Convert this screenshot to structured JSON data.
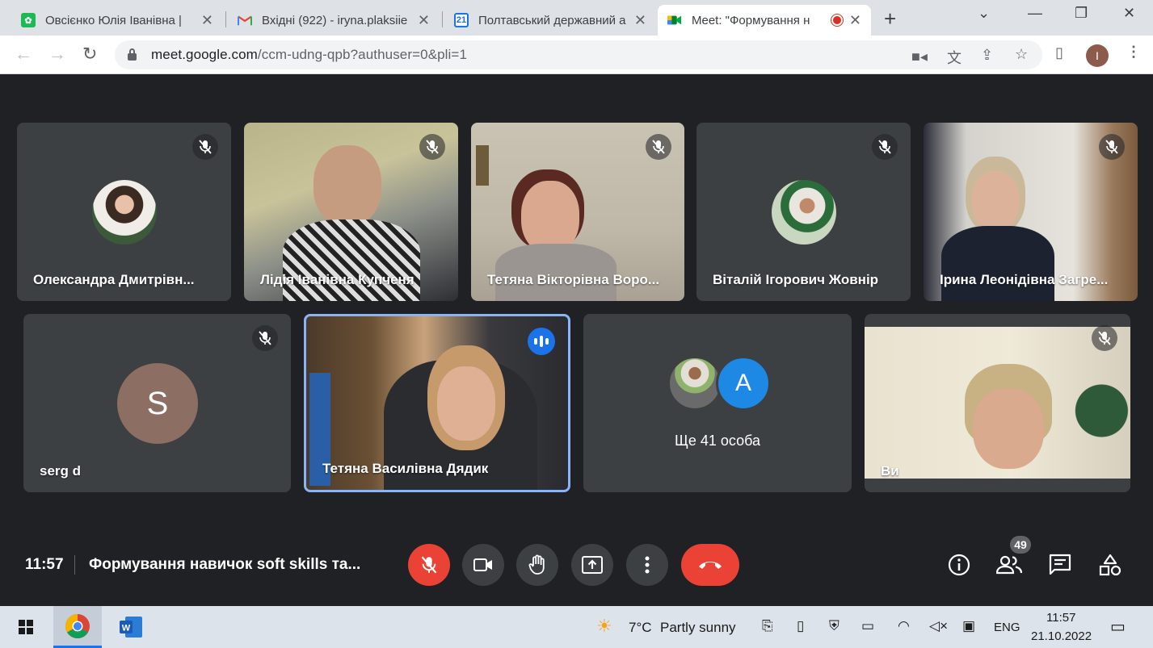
{
  "browser": {
    "tabs": [
      {
        "title": "Овсієнко Юлія Іванівна | ",
        "favicon": "green-app-icon",
        "color": "#1db954"
      },
      {
        "title": "Вхідні (922) - iryna.plaksiie",
        "favicon": "gmail-icon",
        "color": "#ea4335"
      },
      {
        "title": "Полтавський державний а",
        "favicon": "calendar-icon",
        "color": "#1a73e8",
        "favicon_text": "21"
      },
      {
        "title": "Meet: \"Формування н",
        "favicon": "meet-icon",
        "color": "#00832d"
      }
    ],
    "url_main": "meet.google.com",
    "url_rest": "/ccm-udng-qpb?authuser=0&pli=1",
    "profile_initial": "I"
  },
  "meeting": {
    "participants": [
      {
        "name": "Олександра Дмитрівн...",
        "muted": true
      },
      {
        "name": "Лідія Іванівна Купченя",
        "muted": true
      },
      {
        "name": "Тетяна Вікторівна Воро...",
        "muted": true
      },
      {
        "name": "Віталій Ігорович Жовнір",
        "muted": true
      },
      {
        "name": "Ірина Леонідівна Загре...",
        "muted": true
      },
      {
        "name": "serg d",
        "muted": true,
        "initial": "S",
        "avatar_color": "#8d6e63"
      },
      {
        "name": "Тетяна Василівна Дядик",
        "muted": false,
        "speaking": true
      },
      {
        "name": "Ви",
        "muted": true
      }
    ],
    "others": {
      "label": "Ще 41 особа",
      "initial": "A",
      "avatar_color": "#1e88e5"
    },
    "time": "11:57",
    "title": "Формування навичок soft skills та...",
    "people_count": "49"
  },
  "taskbar": {
    "weather_temp": "7°C",
    "weather_text": "Partly sunny",
    "lang": "ENG",
    "time": "11:57",
    "date": "21.10.2022"
  }
}
